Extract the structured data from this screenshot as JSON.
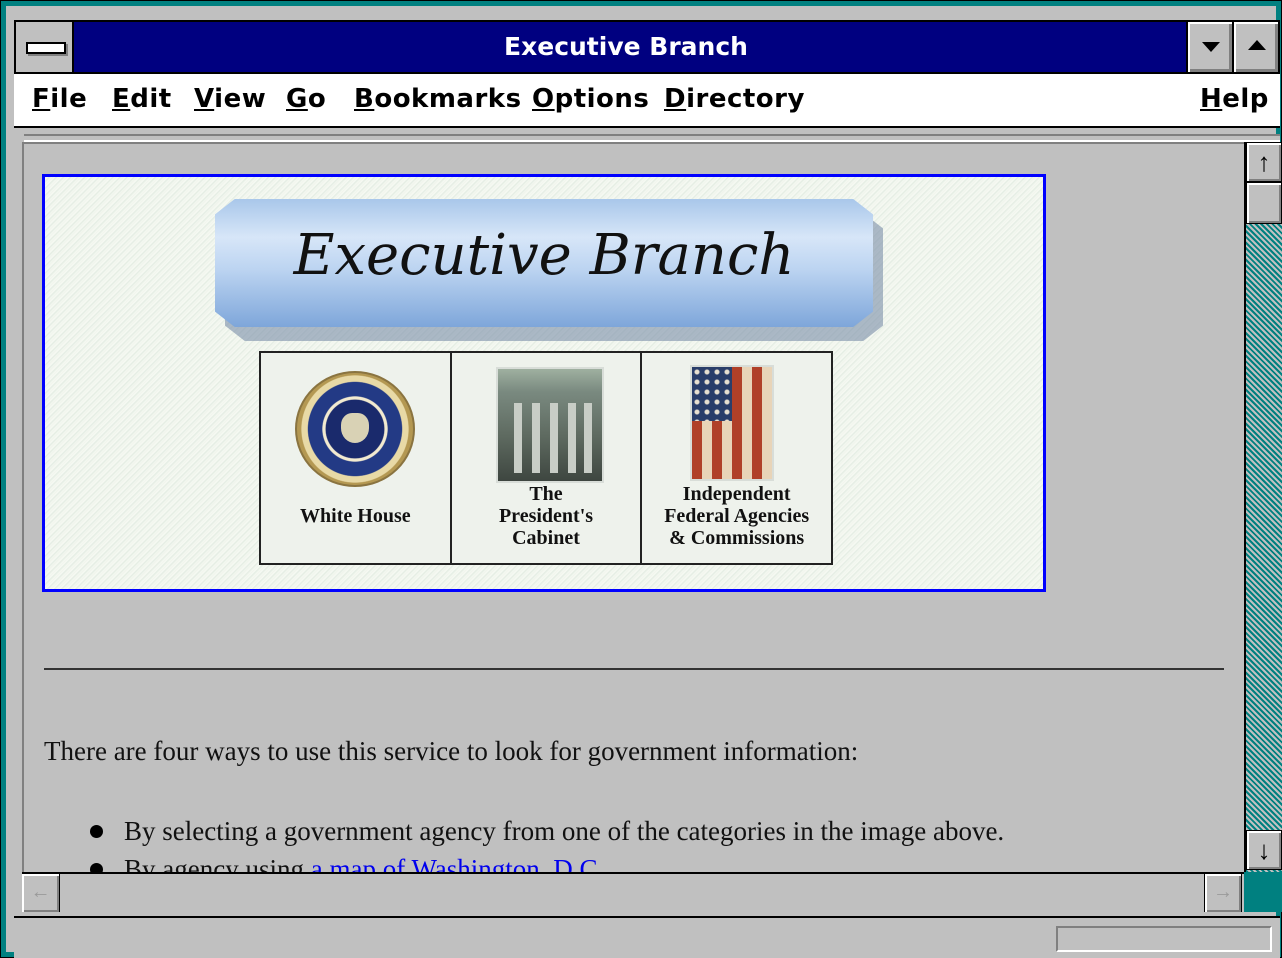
{
  "window": {
    "title": "Executive Branch"
  },
  "menubar": {
    "items": [
      {
        "label": "File",
        "mnemonic": "F",
        "rest": "ile"
      },
      {
        "label": "Edit",
        "mnemonic": "E",
        "rest": "dit"
      },
      {
        "label": "View",
        "mnemonic": "V",
        "rest": "iew"
      },
      {
        "label": "Go",
        "mnemonic": "G",
        "rest": "o"
      },
      {
        "label": "Bookmarks",
        "mnemonic": "B",
        "rest": "ookmarks"
      },
      {
        "label": "Options",
        "mnemonic": "O",
        "rest": "ptions"
      },
      {
        "label": "Directory",
        "mnemonic": "D",
        "rest": "irectory"
      },
      {
        "label": "Help",
        "mnemonic": "H",
        "rest": "elp"
      }
    ]
  },
  "banner": {
    "heading": "Executive Branch",
    "cells": [
      {
        "label_lines": [
          "White House"
        ],
        "icon": "presidential-seal-icon"
      },
      {
        "label_lines": [
          "The",
          "President's",
          "Cabinet"
        ],
        "icon": "cabinet-building-icon"
      },
      {
        "label_lines": [
          "Independent",
          "Federal Agencies",
          "& Commissions"
        ],
        "icon": "american-flag-icon"
      }
    ]
  },
  "content": {
    "intro": "There are four ways to use this service to look for government information:",
    "bullets": [
      {
        "text": "By selecting a government agency from one of the categories in the image above.",
        "prefix": "",
        "link": ""
      },
      {
        "text": "",
        "prefix": "By agency using ",
        "link": "a map of Washington, D.C."
      }
    ]
  },
  "scrollbar": {
    "up_glyph": "↑",
    "down_glyph": "↓",
    "left_glyph": "←",
    "right_glyph": "→"
  },
  "statusbar": {
    "text": ""
  },
  "colors": {
    "title_bar": "#000080",
    "window_frame": "#008080",
    "link": "#0000ee",
    "banner_border": "#0000ff"
  }
}
